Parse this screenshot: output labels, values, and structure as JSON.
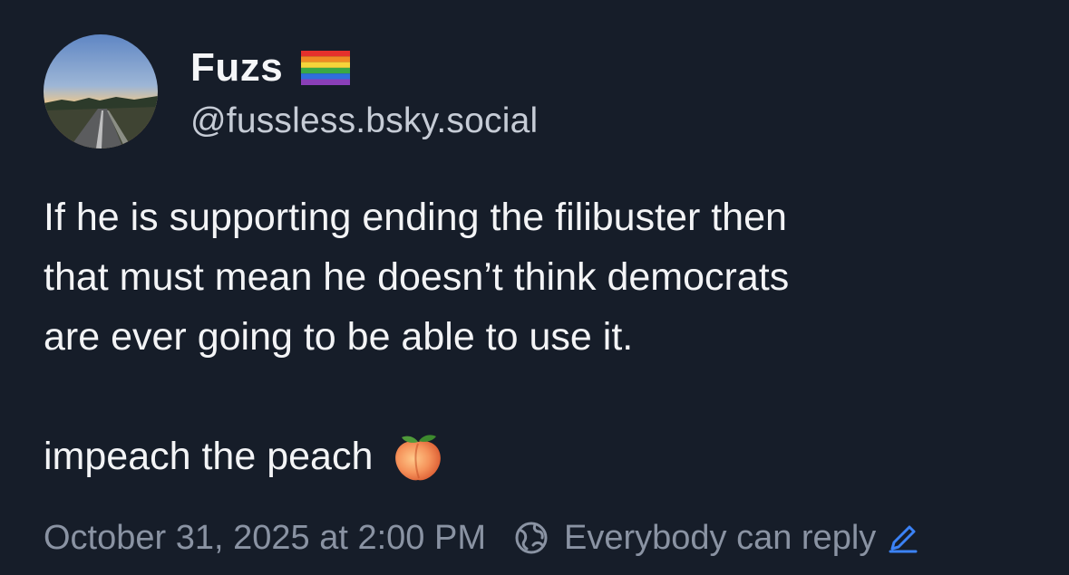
{
  "author": {
    "display_name": "Fuzs",
    "handle": "@fussless.bsky.social",
    "avatar_icon": "landscape-road-photo",
    "badge_icon": "rainbow-flag-icon"
  },
  "post": {
    "paragraph_1": "If he is supporting ending the filibuster then\nthat must mean he doesn’t think democrats\nare ever going to be able to use it.",
    "paragraph_2": "impeach the peach",
    "emoji_icon": "peach-icon"
  },
  "meta": {
    "timestamp": "October 31, 2025 at 2:00 PM",
    "reply_setting": "Everybody can reply",
    "globe_icon": "globe-icon",
    "edit_icon": "pencil-icon"
  },
  "colors": {
    "background": "#161d29",
    "text_primary": "#f3f4f6",
    "text_secondary": "#c6ccd6",
    "text_muted": "#8a93a3",
    "accent": "#3b82f6"
  }
}
